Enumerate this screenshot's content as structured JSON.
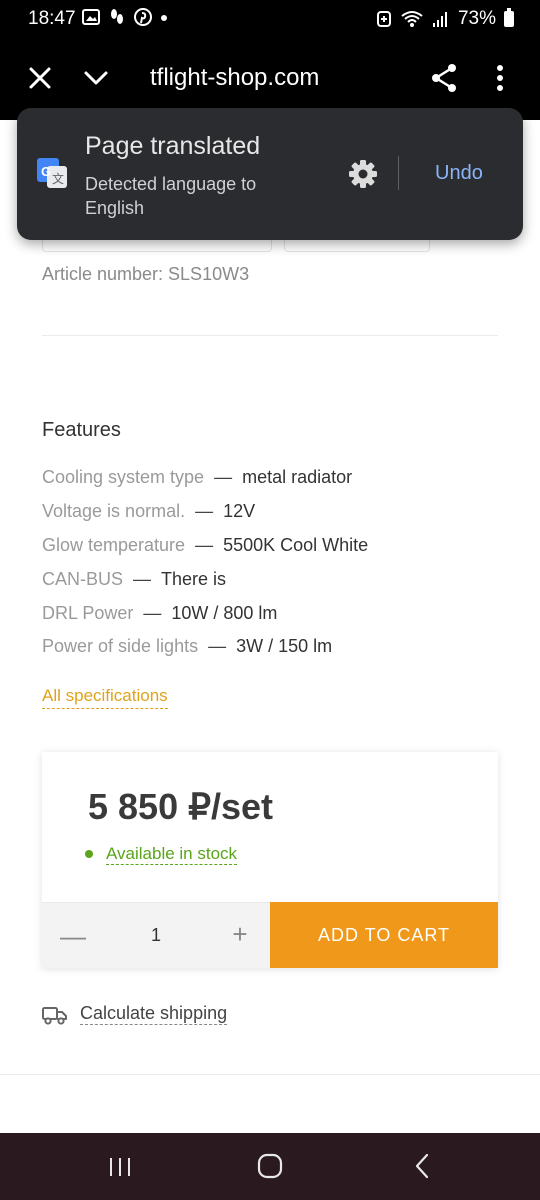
{
  "status_bar": {
    "time": "18:47",
    "battery": "73%"
  },
  "toolbar": {
    "url": "tflight-shop.com"
  },
  "translate_popup": {
    "title": "Page translated",
    "subtitle": "Detected language to English",
    "undo_label": "Undo"
  },
  "product": {
    "article_number": "Article number: SLS10W3",
    "features_title": "Features",
    "features": [
      {
        "key": "Cooling system type",
        "dash": "—",
        "value": "metal radiator"
      },
      {
        "key": "Voltage is normal.",
        "dash": "—",
        "value": "12V"
      },
      {
        "key": "Glow temperature",
        "dash": "—",
        "value": "5500K Cool White"
      },
      {
        "key": "CAN-BUS",
        "dash": "—",
        "value": "There is"
      },
      {
        "key": "DRL Power",
        "dash": "—",
        "value": "10W / 800 lm"
      },
      {
        "key": "Power of side lights",
        "dash": "—",
        "value": "3W / 150 lm"
      }
    ],
    "all_specs_label": "All specifications"
  },
  "purchase": {
    "price": "5 850 ₽/set",
    "stock": "Available in stock",
    "qty_minus": "—",
    "quantity": "1",
    "qty_plus": "+",
    "add_to_cart": "ADD TO CART",
    "shipping": "Calculate shipping"
  },
  "colors": {
    "accent": "#f0981a",
    "link": "#e0a21a",
    "stock": "#5aa51b",
    "popup_bg": "#2b2c2f",
    "undo": "#8ab4f8"
  }
}
